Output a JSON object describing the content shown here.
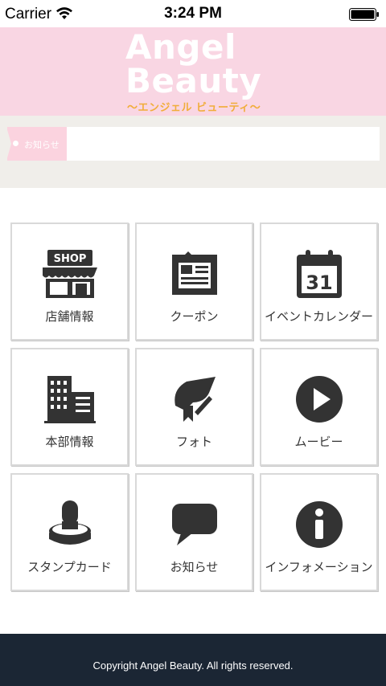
{
  "status_bar": {
    "carrier": "Carrier",
    "time": "3:24 PM",
    "wifi_icon": "wifi-icon",
    "battery_icon": "battery-icon"
  },
  "header": {
    "brand_line1": "Angel",
    "brand_line2": "Beauty",
    "subtitle": "〜エンジェル ビューティ〜",
    "background_color": "#f9d6e3",
    "subtitle_color": "#f1ad3a"
  },
  "notice": {
    "tag_label": "お知らせ",
    "text": "",
    "tag_color": "#fbd3df"
  },
  "menu": [
    {
      "label": "店舗情報",
      "icon": "shop-icon"
    },
    {
      "label": "クーポン",
      "icon": "coupon-icon"
    },
    {
      "label": "イベントカレンダー",
      "icon": "calendar-icon",
      "icon_text": "31"
    },
    {
      "label": "本部情報",
      "icon": "building-icon"
    },
    {
      "label": "フォト",
      "icon": "photo-icon"
    },
    {
      "label": "ムービー",
      "icon": "play-icon"
    },
    {
      "label": "スタンプカード",
      "icon": "stamp-icon"
    },
    {
      "label": "お知らせ",
      "icon": "speech-bubble-icon"
    },
    {
      "label": "インフォメーション",
      "icon": "info-icon"
    }
  ],
  "shop_icon_text": "SHOP",
  "footer": {
    "copyright": "Copyright Angel Beauty. All rights reserved.",
    "background_color": "#1b2634"
  }
}
